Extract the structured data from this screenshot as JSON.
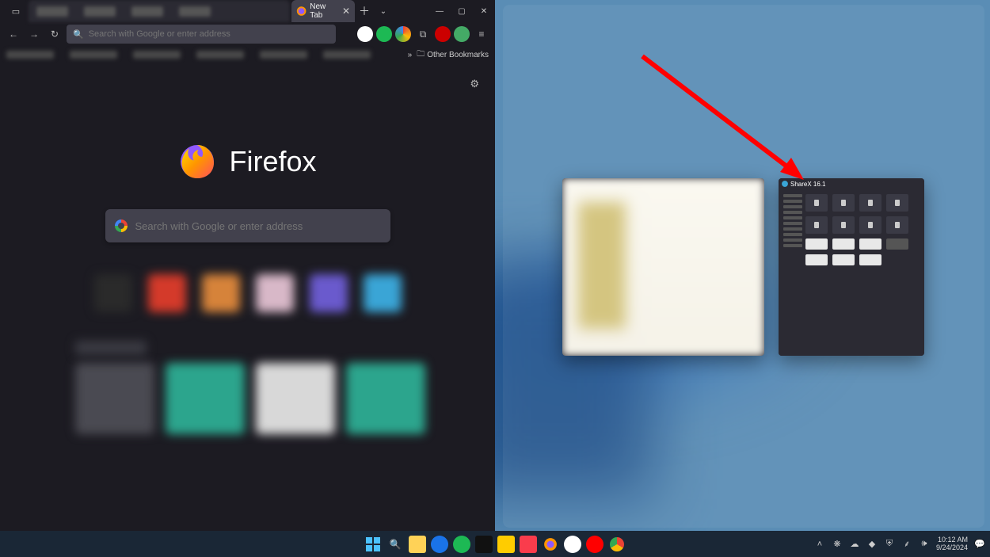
{
  "firefox": {
    "tab_active_label": "New Tab",
    "url_placeholder": "Search with Google or enter address",
    "bookmarks_overflow_label": "Other Bookmarks",
    "brand_word": "Firefox",
    "center_search_placeholder": "Search with Google or enter address",
    "window_buttons": {
      "min": "—",
      "max": "▢",
      "close": "✕"
    },
    "nav": {
      "back": "←",
      "forward": "→",
      "reload": "↻"
    },
    "tile_colors": [
      "#2a2a2a",
      "#d43a2a",
      "#d6833a",
      "#d8b8c8",
      "#eadf60",
      "#3aa5d6"
    ]
  },
  "snap_assist": {
    "thumb2_title": "ShareX 16.1"
  },
  "taskbar": {
    "clock_time": "10:12 AM",
    "clock_date": "9/24/2024",
    "tray_icons": [
      "chevron-up",
      "flower",
      "cloud",
      "steam",
      "shield",
      "wifi",
      "volume"
    ],
    "pinned": [
      {
        "name": "start"
      },
      {
        "name": "search"
      },
      {
        "name": "explorer"
      },
      {
        "name": "edge"
      },
      {
        "name": "spotify"
      },
      {
        "name": "app1"
      },
      {
        "name": "app2"
      },
      {
        "name": "music"
      },
      {
        "name": "firefox"
      },
      {
        "name": "slack"
      },
      {
        "name": "youtube"
      },
      {
        "name": "chrome"
      }
    ]
  }
}
